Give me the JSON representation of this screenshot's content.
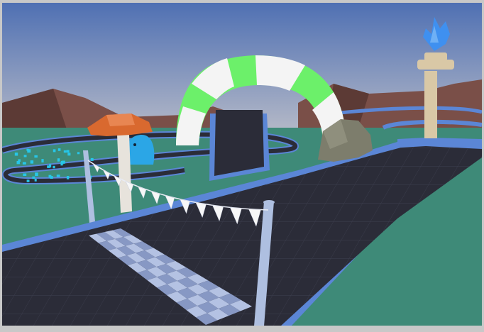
{
  "scene": {
    "colors": {
      "frame": "#c8c8c8",
      "sky_top": "#4f70b3",
      "sky_bottom": "#b9bcc8",
      "mountain": "#7a4f48",
      "mountain_shade": "#5c3a35",
      "ground": "#3e8a78",
      "track": "#2b2c38",
      "track_grid": "#3b3d4c",
      "track_edge": "#5b86d6",
      "arch_green": "#6cf06a",
      "arch_white": "#f4f4f4",
      "rock": "#7d7d6c",
      "mushroom_cap": "#d9692f",
      "mushroom_stem": "#e7e3dc",
      "blob": "#2ba6e6",
      "pillar": "#d9c8a6",
      "crystal": "#3f90f0",
      "pole": "#aebfe0",
      "flag": "#f7f7f7",
      "checker_light": "#b4c2e3",
      "checker_dark": "#8798c4",
      "cubes": "#27c6e8"
    },
    "objects": [
      "start-finish-banner",
      "checkered-start-line",
      "striped-arch",
      "boulder",
      "mushroom",
      "blue-blob-creature",
      "stone-pillar",
      "blue-crystal",
      "cube-cluster",
      "mountains",
      "race-track"
    ]
  }
}
